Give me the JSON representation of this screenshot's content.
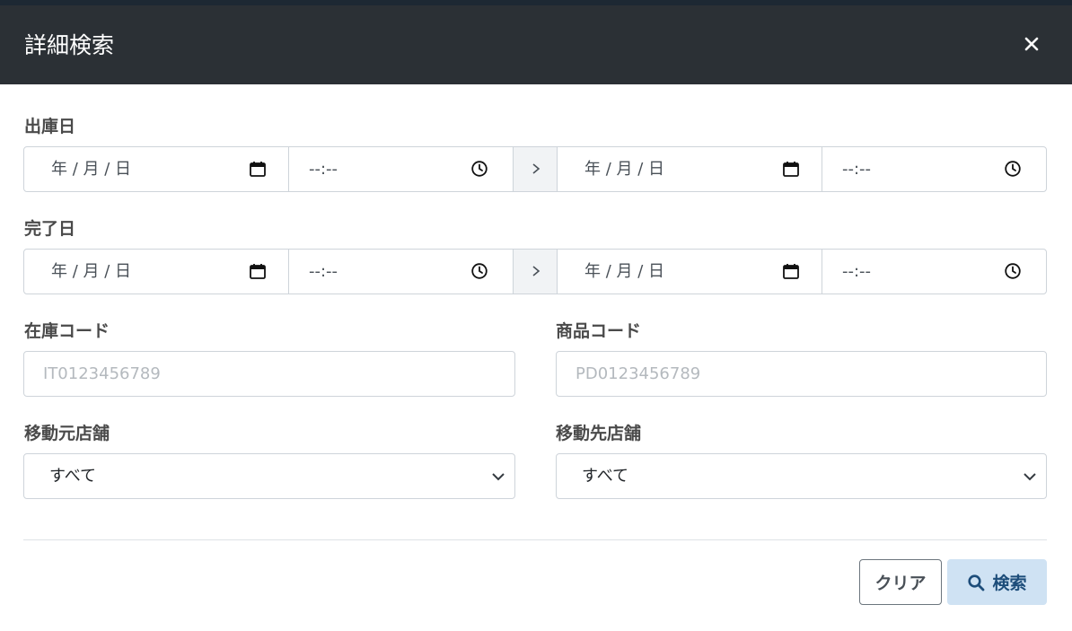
{
  "modal": {
    "title": "詳細検索"
  },
  "shipping_date": {
    "label": "出庫日",
    "from_date": "年 / 月 / 日",
    "from_time": "--:--",
    "to_date": "年 / 月 / 日",
    "to_time": "--:--"
  },
  "completion_date": {
    "label": "完了日",
    "from_date": "年 / 月 / 日",
    "from_time": "--:--",
    "to_date": "年 / 月 / 日",
    "to_time": "--:--"
  },
  "stock_code": {
    "label": "在庫コード",
    "placeholder": "IT0123456789",
    "value": ""
  },
  "product_code": {
    "label": "商品コード",
    "placeholder": "PD0123456789",
    "value": ""
  },
  "source_store": {
    "label": "移動元店舗",
    "selected": "すべて"
  },
  "destination_store": {
    "label": "移動先店舗",
    "selected": "すべて"
  },
  "buttons": {
    "clear": "クリア",
    "search": "検索"
  },
  "icons": {
    "close": "close-icon",
    "calendar": "calendar-icon",
    "clock": "clock-icon",
    "range_arrow": "chevron-right-icon",
    "select": "chevron-down-icon",
    "search": "search-icon"
  },
  "colors": {
    "header_bg": "#2b3035",
    "search_button_bg": "#cfe2f3",
    "search_button_text": "#1d4d7a"
  }
}
